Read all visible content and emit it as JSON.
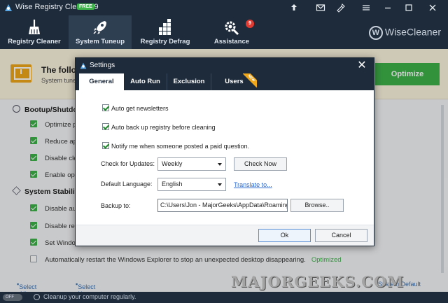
{
  "app": {
    "title": "Wise Registry Cleaner 9",
    "edition_badge": "FREE"
  },
  "titlebar_icons": [
    "upload-icon",
    "mail-icon",
    "theme-icon",
    "menu-icon",
    "minimize-icon",
    "maximize-icon",
    "close-icon"
  ],
  "nav": {
    "items": [
      {
        "label": "Registry Cleaner",
        "icon": "broom-icon"
      },
      {
        "label": "System Tuneup",
        "icon": "rocket-icon",
        "active": true
      },
      {
        "label": "Registry Defrag",
        "icon": "defrag-blocks-icon"
      },
      {
        "label": "Assistance",
        "icon": "gear-wrench-icon",
        "badge": "9"
      }
    ],
    "brand": "WiseCleaner",
    "brand_logo": "W"
  },
  "banner": {
    "heading": "The follov",
    "subtext": "System tune",
    "optimize_label": "Optimize"
  },
  "background_sections": [
    {
      "title": "Bootup/Shutdov",
      "icon": "power-icon",
      "rows": [
        {
          "label": "Optimize pr",
          "checked": true
        },
        {
          "label": "Reduce app",
          "checked": true
        },
        {
          "label": "Disable clea",
          "checked": true
        },
        {
          "label": "Enable optin",
          "checked": true
        }
      ]
    },
    {
      "title": "System Stability",
      "icon": "cube-icon",
      "rows": [
        {
          "label": "Disable auto",
          "checked": true
        },
        {
          "label": "Disable regi",
          "checked": true
        },
        {
          "label": "Set Window",
          "checked": true
        },
        {
          "label": "Automatically restart the Windows Explorer to stop an unexpected desktop disappearing.",
          "checked": false,
          "tag": "Optimized"
        }
      ]
    }
  ],
  "select_bar": {
    "select_all": "Select All",
    "select_none": "Select None",
    "system_default": "System Default"
  },
  "statusbar": {
    "toggle_label": "OFF",
    "message": "Cleanup your computer regularly."
  },
  "watermark": "MAJORGEEKS.COM",
  "dialog": {
    "title": "Settings",
    "tabs": [
      {
        "label": "General",
        "active": true
      },
      {
        "label": "Auto Run"
      },
      {
        "label": "Exclusion"
      },
      {
        "label": "Users",
        "badge": "NEW"
      }
    ],
    "checkboxes": [
      {
        "label": "Auto get newsletters",
        "checked": true
      },
      {
        "label": "Auto back up registry before cleaning",
        "checked": true
      },
      {
        "label": "Notify me when someone posted a paid question.",
        "checked": true
      }
    ],
    "updates": {
      "label": "Check for Updates:",
      "value": "Weekly",
      "button": "Check Now"
    },
    "language": {
      "label": "Default Language:",
      "value": "English",
      "link": "Translate to..."
    },
    "backup": {
      "label": "Backup to:",
      "path": "C:\\Users\\Jon - MajorGeeks\\AppData\\Roaming\\...",
      "button": "Browse.."
    },
    "ok_label": "Ok",
    "cancel_label": "Cancel"
  },
  "colors": {
    "navy": "#1e2b3b",
    "accent_green": "#3db34a",
    "badge_red": "#e03b32",
    "link_blue": "#2a6ad1",
    "warning_orange": "#f0a71a"
  }
}
